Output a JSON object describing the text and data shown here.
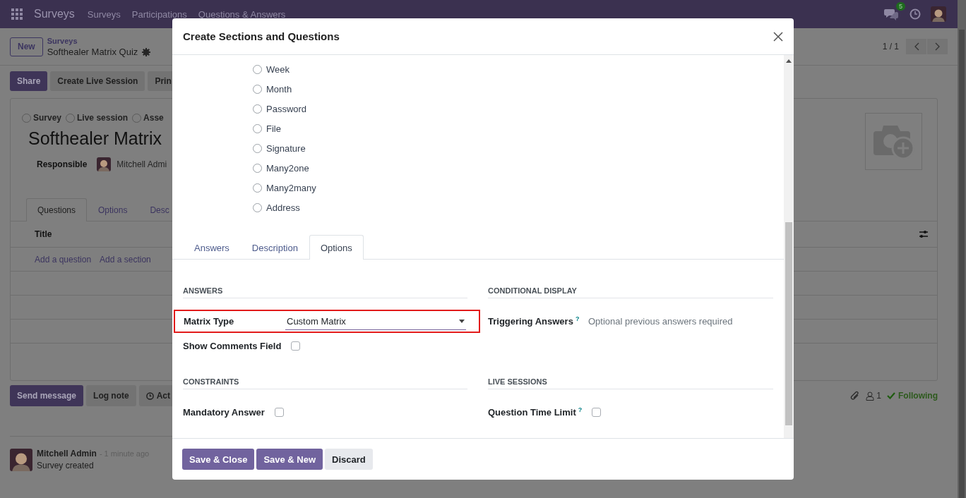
{
  "navbar": {
    "app": "Surveys",
    "menu": [
      "Surveys",
      "Participations",
      "Questions & Answers"
    ],
    "chat_badge": "5"
  },
  "control_panel": {
    "new": "New",
    "breadcrumb": "Surveys",
    "record": "Softhealer Matrix Quiz",
    "pager": "1 / 1"
  },
  "actions": [
    {
      "label": "Share",
      "kind": "primary"
    },
    {
      "label": "Create Live Session",
      "kind": "secondary"
    },
    {
      "label": "Prin",
      "kind": "secondary"
    }
  ],
  "form": {
    "survey_types": [
      {
        "label": "Survey",
        "selected": false
      },
      {
        "label": "Live session",
        "selected": false
      },
      {
        "label": "Asse",
        "selected": false
      }
    ],
    "title": "Softhealer Matrix",
    "responsible_label": "Responsible",
    "responsible": "Mitchell Admi",
    "tabs": [
      {
        "label": "Questions",
        "selected": true
      },
      {
        "label": "Options",
        "selected": false
      },
      {
        "label": "Desc",
        "selected": false
      }
    ],
    "column": "Title",
    "links": [
      "Add a question",
      "Add a section"
    ]
  },
  "chatter": {
    "buttons": [
      {
        "label": "Send message",
        "kind": "primary"
      },
      {
        "label": "Log note",
        "kind": "secondary"
      },
      {
        "label": "Act",
        "kind": "activity"
      }
    ],
    "followers": "1",
    "following": "Following",
    "message": {
      "author": "Mitchell Admin",
      "time": "- 1 minute ago",
      "body": "Survey created"
    }
  },
  "dialog": {
    "title": "Create Sections and Questions",
    "question_types": [
      {
        "label": "Week",
        "selected": false
      },
      {
        "label": "Month",
        "selected": false
      },
      {
        "label": "Password",
        "selected": false
      },
      {
        "label": "File",
        "selected": false
      },
      {
        "label": "Signature",
        "selected": false
      },
      {
        "label": "Many2one",
        "selected": false
      },
      {
        "label": "Many2many",
        "selected": false
      },
      {
        "label": "Address",
        "selected": false
      }
    ],
    "tabs": [
      {
        "label": "Answers",
        "selected": false
      },
      {
        "label": "Description",
        "selected": false
      },
      {
        "label": "Options",
        "selected": true
      }
    ],
    "groups": [
      {
        "title": "ANSWERS",
        "fields": [
          {
            "kind": "select",
            "label": "Matrix Type",
            "value": "Custom Matrix",
            "highlighted": true
          },
          {
            "kind": "checkbox",
            "label": "Show Comments Field",
            "checked": false
          }
        ]
      },
      {
        "title": "CONDITIONAL DISPLAY",
        "fields": [
          {
            "kind": "tags",
            "label": "Triggering Answers",
            "help": "?",
            "placeholder": "Optional previous answers required"
          }
        ]
      },
      {
        "title": "CONSTRAINTS",
        "fields": [
          {
            "kind": "checkbox",
            "label": "Mandatory Answer",
            "checked": false
          }
        ]
      },
      {
        "title": "LIVE SESSIONS",
        "fields": [
          {
            "kind": "checkbox",
            "label": "Question Time Limit",
            "help": "?",
            "checked": false
          }
        ]
      }
    ],
    "buttons": [
      {
        "label": "Save & Close",
        "kind": "primary"
      },
      {
        "label": "Save & New",
        "kind": "primary"
      },
      {
        "label": "Discard",
        "kind": "secondary"
      }
    ]
  }
}
